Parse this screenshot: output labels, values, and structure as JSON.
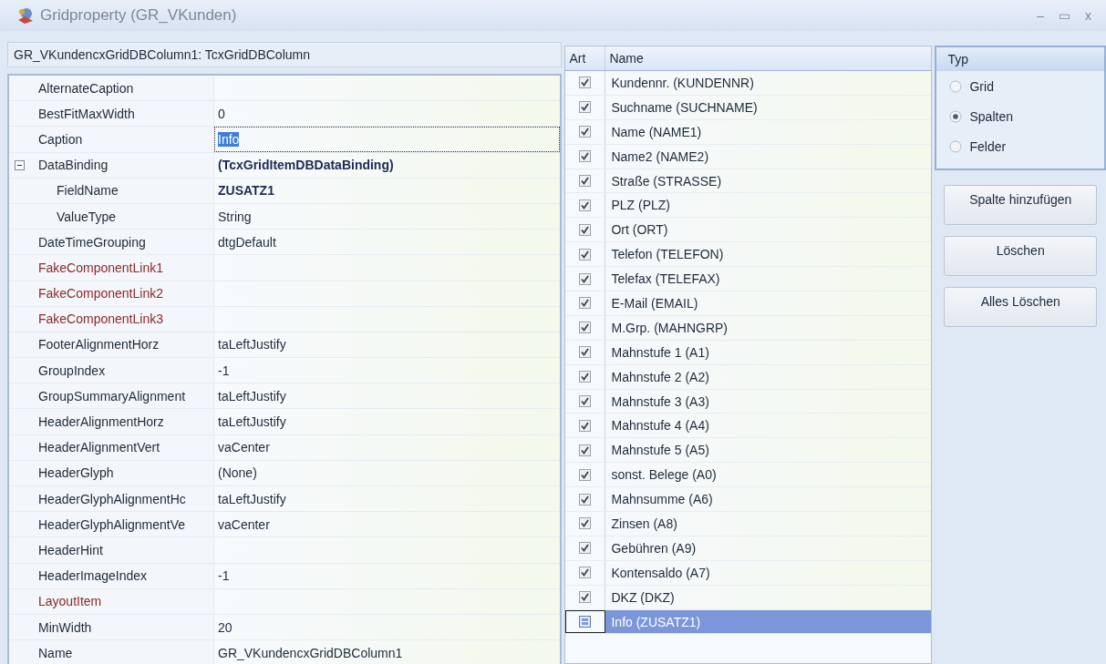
{
  "window": {
    "title": "Gridproperty (GR_VKunden)",
    "controls": [
      "–",
      "▭",
      "x"
    ]
  },
  "inspector": {
    "header": "GR_VKundencxGridDBColumn1: TcxGridDBColumn",
    "rows": [
      {
        "kind": "property",
        "name": "AlternateCaption",
        "value": ""
      },
      {
        "kind": "property",
        "name": "BestFitMaxWidth",
        "value": "0",
        "bold": false
      },
      {
        "kind": "editing",
        "name": "Caption",
        "value": "Info",
        "bold": false
      },
      {
        "kind": "category",
        "name": "DataBinding",
        "value": "(TcxGridItemDBDataBinding)",
        "bold": true,
        "expanded": true,
        "children": [
          {
            "name": "FieldName",
            "value": "ZUSATZ1",
            "bold": true
          },
          {
            "name": "ValueType",
            "value": "String",
            "bold": false
          }
        ]
      },
      {
        "kind": "property",
        "name": "DateTimeGrouping",
        "value": "dtgDefault",
        "bold": false
      },
      {
        "kind": "link",
        "name": "FakeComponentLink1",
        "value": ""
      },
      {
        "kind": "link",
        "name": "FakeComponentLink2",
        "value": ""
      },
      {
        "kind": "link",
        "name": "FakeComponentLink3",
        "value": ""
      },
      {
        "kind": "property",
        "name": "FooterAlignmentHorz",
        "value": "taLeftJustify",
        "bold": false
      },
      {
        "kind": "property",
        "name": "GroupIndex",
        "value": "-1",
        "bold": false
      },
      {
        "kind": "property",
        "name": "GroupSummaryAlignment",
        "value": "taLeftJustify",
        "bold": false
      },
      {
        "kind": "property",
        "name": "HeaderAlignmentHorz",
        "value": "taLeftJustify",
        "bold": false
      },
      {
        "kind": "property",
        "name": "HeaderAlignmentVert",
        "value": "vaCenter",
        "bold": false
      },
      {
        "kind": "property",
        "name": "HeaderGlyph",
        "value": "(None)",
        "bold": false
      },
      {
        "kind": "property",
        "name": "HeaderGlyphAlignmentHc",
        "value": "taLeftJustify",
        "bold": false
      },
      {
        "kind": "property",
        "name": "HeaderGlyphAlignmentVe",
        "value": "vaCenter",
        "bold": false
      },
      {
        "kind": "property",
        "name": "HeaderHint",
        "value": ""
      },
      {
        "kind": "property",
        "name": "HeaderImageIndex",
        "value": "-1",
        "bold": false
      },
      {
        "kind": "link",
        "name": "LayoutItem",
        "value": ""
      },
      {
        "kind": "property",
        "name": "MinWidth",
        "value": "20",
        "bold": false
      },
      {
        "kind": "property",
        "name": "Name",
        "value": "GR_VKundencxGridDBColumn1",
        "bold": false
      }
    ]
  },
  "columns_list": {
    "columns": [
      "Art",
      "Name"
    ],
    "items": [
      {
        "kind": "check",
        "checked": true,
        "selected": false,
        "label": "Kundennr. (KUNDENNR)"
      },
      {
        "kind": "check",
        "checked": true,
        "selected": false,
        "label": "Suchname (SUCHNAME)"
      },
      {
        "kind": "check",
        "checked": true,
        "selected": false,
        "label": "Name (NAME1)"
      },
      {
        "kind": "check",
        "checked": true,
        "selected": false,
        "label": "Name2 (NAME2)"
      },
      {
        "kind": "check",
        "checked": true,
        "selected": false,
        "label": "Straße (STRASSE)"
      },
      {
        "kind": "check",
        "checked": true,
        "selected": false,
        "label": "PLZ (PLZ)"
      },
      {
        "kind": "check",
        "checked": true,
        "selected": false,
        "label": "Ort (ORT)"
      },
      {
        "kind": "check",
        "checked": true,
        "selected": false,
        "label": "Telefon (TELEFON)"
      },
      {
        "kind": "check",
        "checked": true,
        "selected": false,
        "label": "Telefax (TELEFAX)"
      },
      {
        "kind": "check",
        "checked": true,
        "selected": false,
        "label": "E-Mail (EMAIL)"
      },
      {
        "kind": "check",
        "checked": true,
        "selected": false,
        "label": "M.Grp. (MAHNGRP)"
      },
      {
        "kind": "check",
        "checked": true,
        "selected": false,
        "label": "Mahnstufe 1 (A1)"
      },
      {
        "kind": "check",
        "checked": true,
        "selected": false,
        "label": "Mahnstufe 2 (A2)"
      },
      {
        "kind": "check",
        "checked": true,
        "selected": false,
        "label": "Mahnstufe 3 (A3)"
      },
      {
        "kind": "check",
        "checked": true,
        "selected": false,
        "label": "Mahnstufe 4 (A4)"
      },
      {
        "kind": "check",
        "checked": true,
        "selected": false,
        "label": "Mahnstufe 5 (A5)"
      },
      {
        "kind": "check",
        "checked": true,
        "selected": false,
        "label": "sonst. Belege (A0)"
      },
      {
        "kind": "check",
        "checked": true,
        "selected": false,
        "label": "Mahnsumme (A6)"
      },
      {
        "kind": "check",
        "checked": true,
        "selected": false,
        "label": "Zinsen (A8)"
      },
      {
        "kind": "check",
        "checked": true,
        "selected": false,
        "label": "Gebühren (A9)"
      },
      {
        "kind": "check",
        "checked": true,
        "selected": false,
        "label": "Kontensaldo (A7)"
      },
      {
        "kind": "check",
        "checked": true,
        "selected": false,
        "label": "DKZ (DKZ)"
      },
      {
        "kind": "indicator",
        "selected": true,
        "label": "Info (ZUSATZ1)"
      }
    ]
  },
  "typ": {
    "title": "Typ",
    "options": [
      {
        "label": "Grid",
        "selected": false
      },
      {
        "label": "Spalten",
        "selected": true
      },
      {
        "label": "Felder",
        "selected": false
      }
    ]
  },
  "buttons": [
    "Spalte hinzufügen",
    "Löschen",
    "Alles Löschen"
  ]
}
